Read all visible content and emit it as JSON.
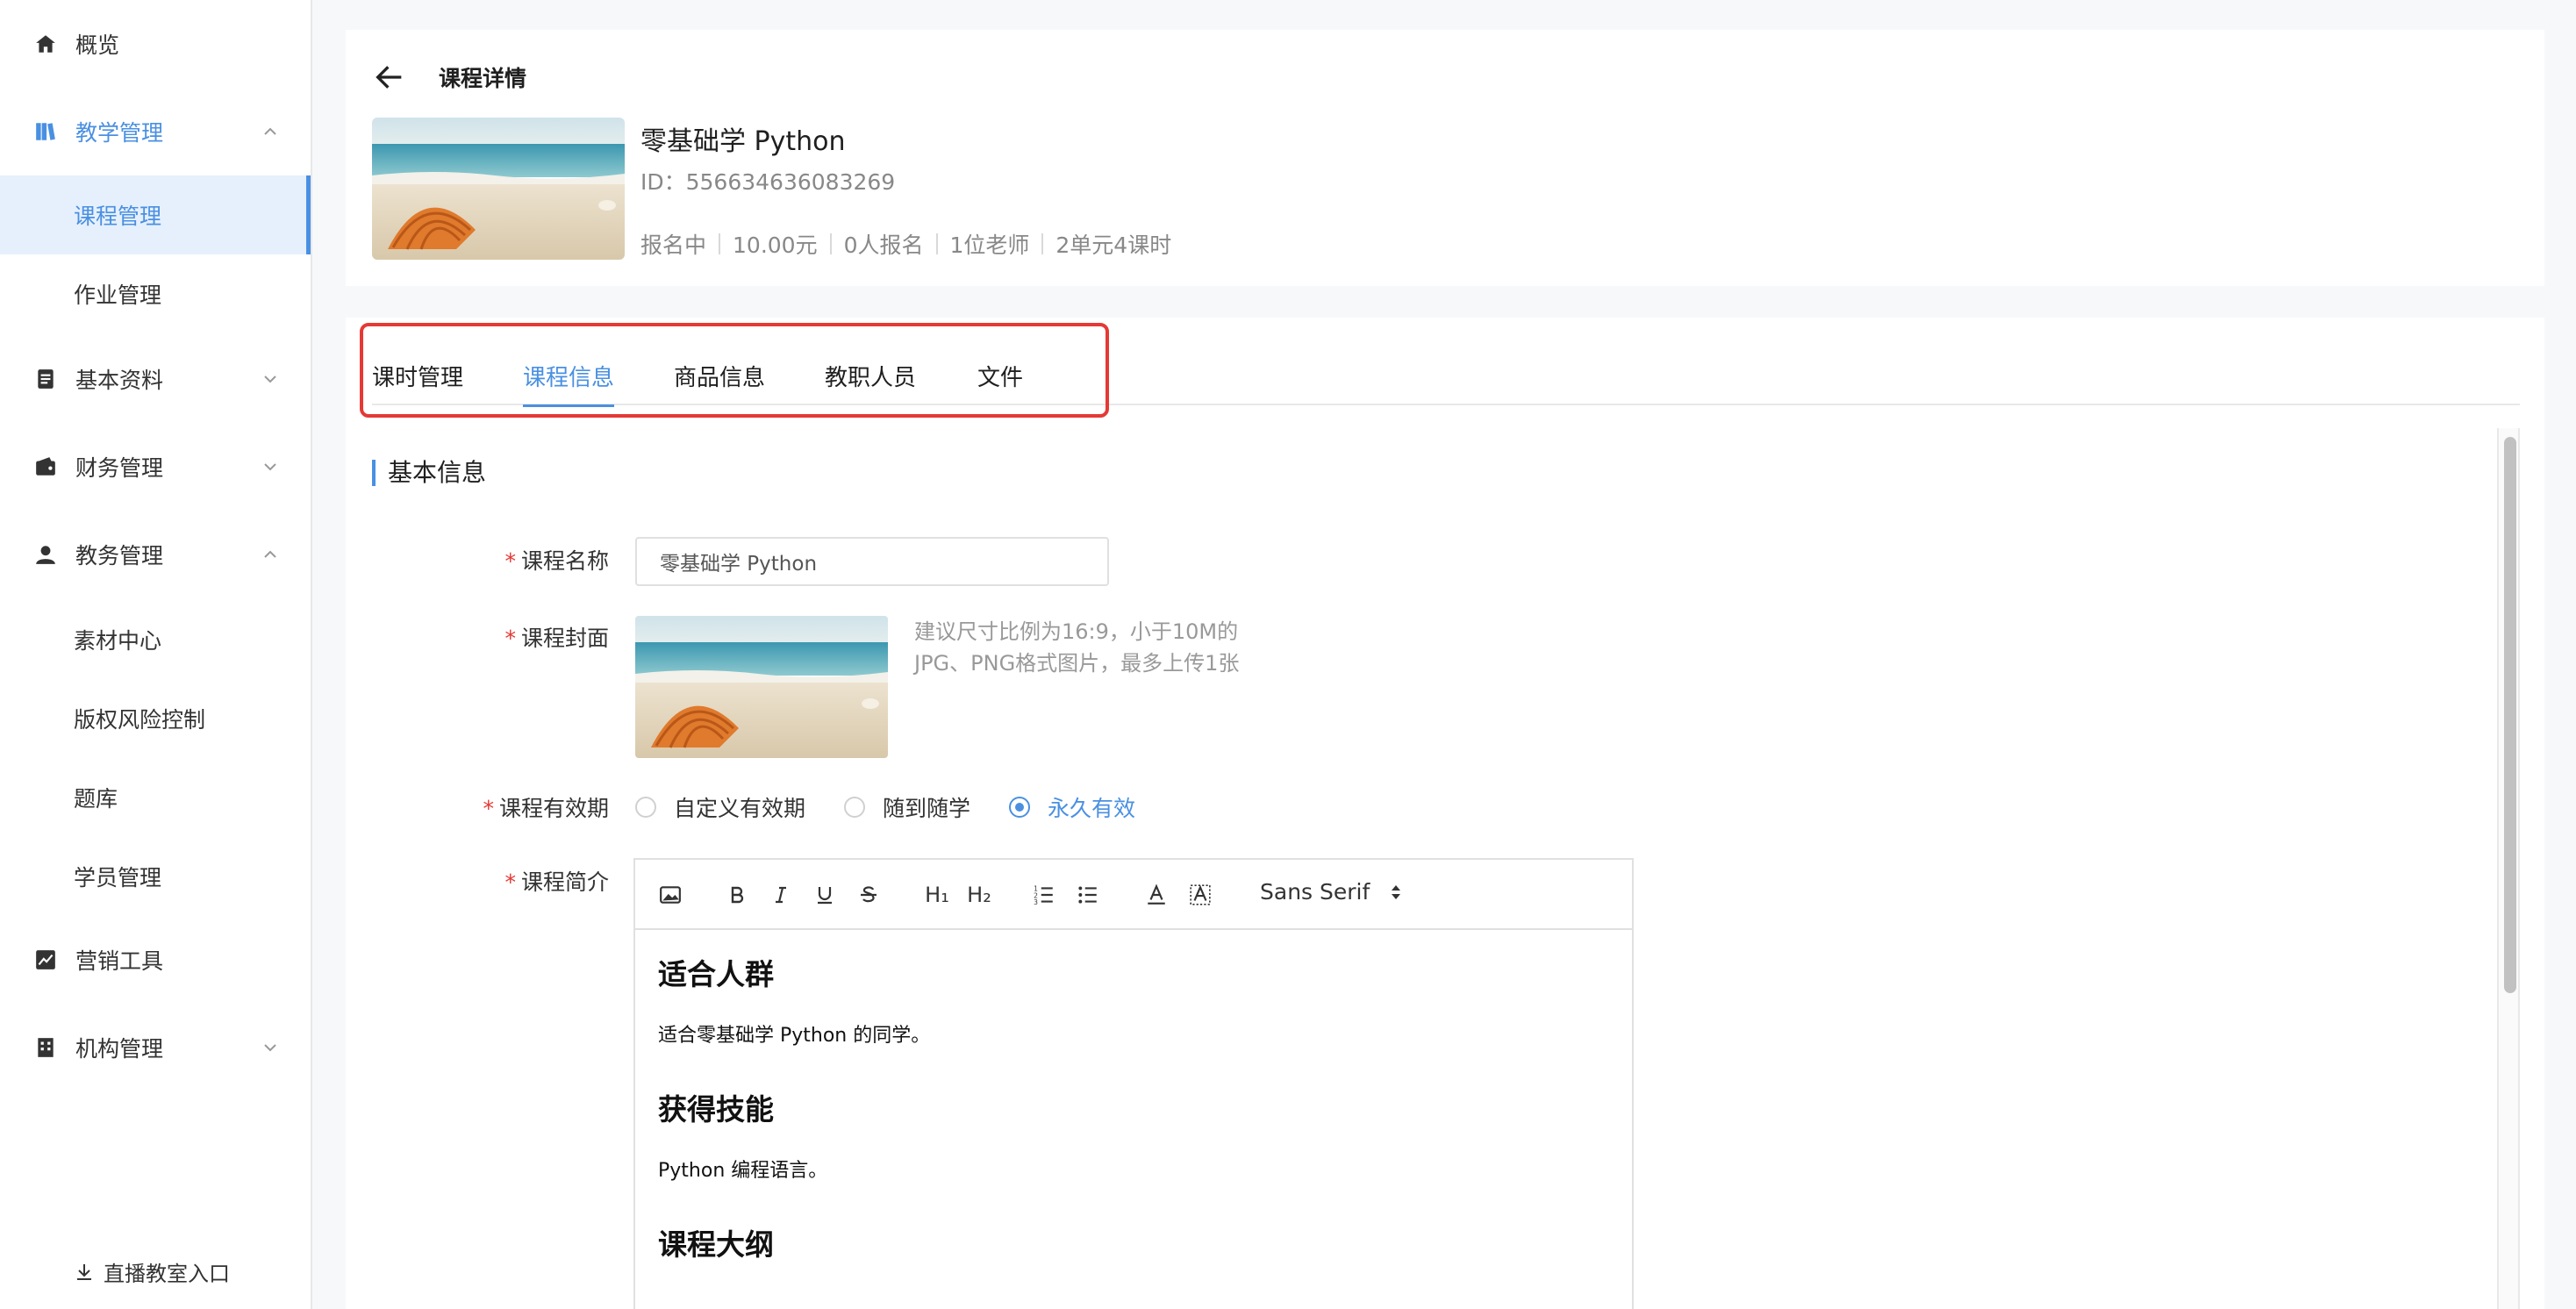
{
  "sidebar": {
    "overview": "概览",
    "teaching": "教学管理",
    "course_mgmt": "课程管理",
    "homework_mgmt": "作业管理",
    "basic_info": "基本资料",
    "finance": "财务管理",
    "academic": "教务管理",
    "material_center": "素材中心",
    "copyright": "版权风险控制",
    "question_bank": "题库",
    "students": "学员管理",
    "marketing": "营销工具",
    "org_mgmt": "机构管理",
    "live_entry": "直播教室入口"
  },
  "header": {
    "title": "课程详情",
    "course_name": "零基础学 Python",
    "id_label": "ID：",
    "id_value": "556634636083269",
    "meta": [
      "报名中",
      "10.00元",
      "0人报名",
      "1位老师",
      "2单元4课时"
    ]
  },
  "tabs": [
    "课时管理",
    "课程信息",
    "商品信息",
    "教职人员",
    "文件"
  ],
  "active_tab": "课程信息",
  "form": {
    "section_title": "基本信息",
    "name_label": "课程名称",
    "name_value": "零基础学 Python",
    "cover_label": "课程封面",
    "cover_hint": "建议尺寸比例为16:9，小于10M的JPG、PNG格式图片，最多上传1张",
    "validity_label": "课程有效期",
    "validity_options": [
      "自定义有效期",
      "随到随学",
      "永久有效"
    ],
    "validity_selected": "永久有效",
    "intro_label": "课程简介",
    "required_mark": "*"
  },
  "editor": {
    "font": "Sans Serif",
    "h1_label": "H₁",
    "h2_label": "H₂",
    "content": {
      "heading1": "适合人群",
      "para1": "适合零基础学 Python 的同学。",
      "heading2": "获得技能",
      "para2": "Python 编程语言。",
      "heading3": "课程大纲"
    }
  },
  "colors": {
    "accent": "#4a90e2",
    "highlight_box": "#e53935",
    "required": "#e53935"
  }
}
